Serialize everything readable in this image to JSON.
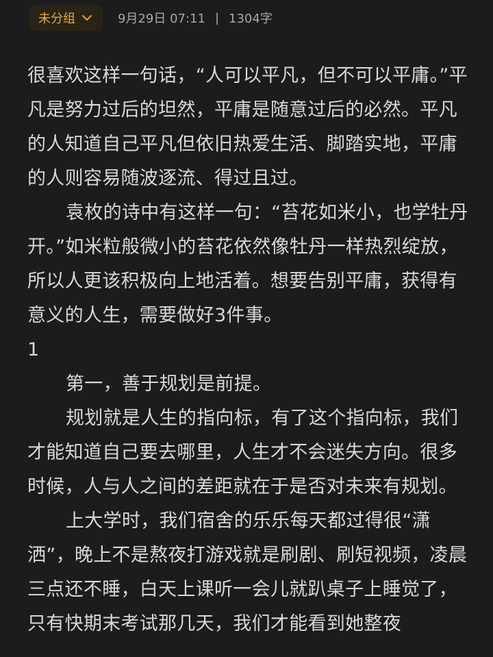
{
  "header": {
    "group_label": "未分组",
    "date": "9月29日 07:11",
    "separator": "|",
    "word_count": "1304字"
  },
  "article": {
    "paragraphs": [
      "很喜欢这样一句话，“人可以平凡，但不可以平庸。”平凡是努力过后的坦然，平庸是随意过后的必然。平凡的人知道自己平凡但依旧热爱生活、脚踏实地，平庸的人则容易随波逐流、得过且过。",
      "袁枚的诗中有这样一句：“苔花如米小，也学牡丹开。”如米粒般微小的苔花依然像牡丹一样热烈绽放，所以人更该积极向上地活着。想要告别平庸，获得有意义的人生，需要做好3件事。",
      "1",
      "第一，善于规划是前提。",
      "规划就是人生的指向标，有了这个指向标，我们才能知道自己要去哪里，人生才不会迷失方向。很多时候，人与人之间的差距就在于是否对未来有规划。",
      "上大学时，我们宿舍的乐乐每天都过得很“潇洒”，晚上不是熬夜打游戏就是刷剧、刷短视频，凌晨三点还不睡，白天上课听一会儿就趴桌子上睡觉了，只有快期末考试那几天，我们才能看到她整夜"
    ]
  },
  "colors": {
    "background": "#1c1c1e",
    "text": "#d8d8d8",
    "accent": "#e6a93a",
    "chip_bg": "#2a2416"
  },
  "icons": [
    "chevron-down-icon"
  ]
}
